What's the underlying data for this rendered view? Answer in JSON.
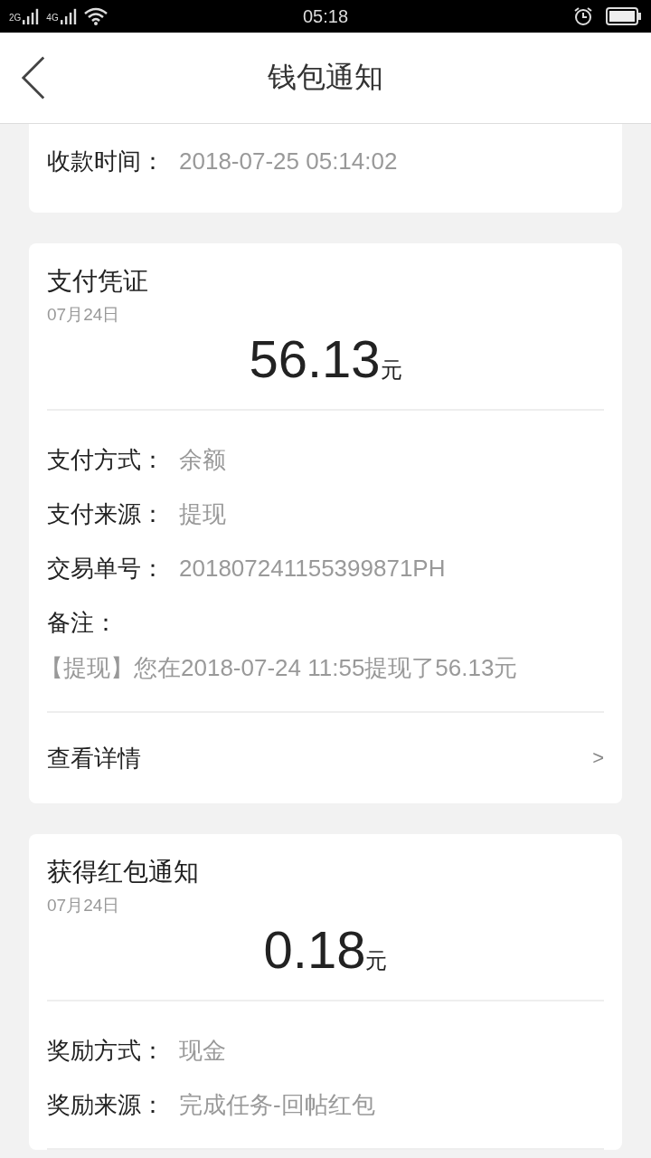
{
  "status_bar": {
    "networks": [
      "2G",
      "4G"
    ],
    "time": "05:18"
  },
  "header": {
    "title": "钱包通知"
  },
  "cards": [
    {
      "fields": [
        {
          "kind": "inline",
          "label": "收款时间：",
          "value": "2018-07-25 05:14:02"
        }
      ]
    },
    {
      "title": "支付凭证",
      "date": "07月24日",
      "amount": "56.13",
      "unit": "元",
      "fields": [
        {
          "kind": "inline",
          "label": "支付方式：",
          "value": "余额"
        },
        {
          "kind": "inline",
          "label": "支付来源：",
          "value": "提现"
        },
        {
          "kind": "inline",
          "label": "交易单号：",
          "value": "201807241155399871PH"
        },
        {
          "kind": "stacked",
          "label": "备注：",
          "value": "【提现】您在2018-07-24 11:55提现了56.13元"
        }
      ],
      "link": {
        "label": "查看详情",
        "arrow": ">"
      }
    },
    {
      "title": "获得红包通知",
      "date": "07月24日",
      "amount": "0.18",
      "unit": "元",
      "fields": [
        {
          "kind": "inline",
          "label": "奖励方式：",
          "value": "现金"
        },
        {
          "kind": "inline",
          "label": "奖励来源：",
          "value": "完成任务-回帖红包"
        }
      ]
    }
  ]
}
